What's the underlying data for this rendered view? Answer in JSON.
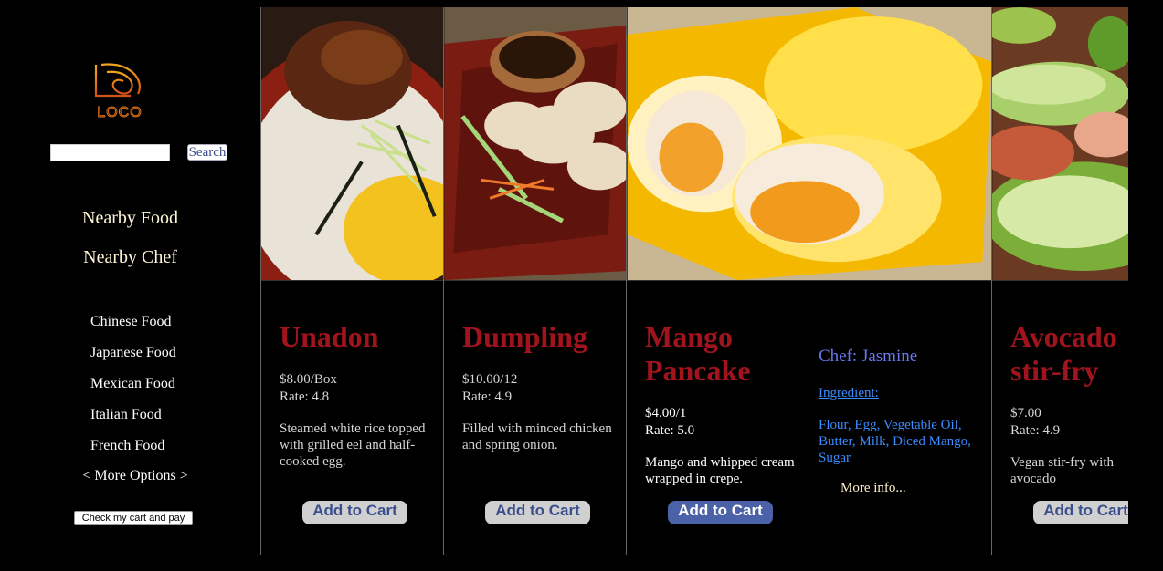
{
  "brand": {
    "logo_text": "LOCO"
  },
  "search": {
    "placeholder": "",
    "button_label": "Search"
  },
  "nav": {
    "primary": [
      "Nearby Food",
      "Nearby Chef"
    ]
  },
  "categories": [
    "Chinese Food",
    "Japanese Food",
    "Mexican Food",
    "Italian Food",
    "French Food"
  ],
  "more_options_label": "< More Options >",
  "checkout_label": "Check my cart and pay",
  "colors": {
    "title": "#a1141d",
    "link": "#3a8cff",
    "chef": "#6a78f0",
    "cart_active": "#4b62a8"
  },
  "items": [
    {
      "name": "Unadon",
      "price": "$8.00/Box",
      "rate": "Rate: 4.8",
      "desc": "Steamed white rice topped with grilled eel and half-cooked egg.",
      "cart_label": "Add to Cart"
    },
    {
      "name": "Dumpling",
      "price": "$10.00/12",
      "rate": "Rate: 4.9",
      "desc": "Filled with minced chicken and spring onion.",
      "cart_label": "Add to Cart"
    },
    {
      "name": "Mango Pancake",
      "price": "$4.00/1",
      "rate": "Rate: 5.0",
      "desc": "Mango and whipped cream wrapped in crepe.",
      "cart_label": "Add to Cart",
      "chef": "Chef: Jasmine",
      "ingredient_label": "Ingredient:",
      "ingredients": "Flour, Egg, Vegetable Oil, Butter, Milk, Diced Mango, Sugar",
      "more_info": "More info..."
    },
    {
      "name": "Avocado stir-fry",
      "price": "$7.00",
      "rate": "Rate: 4.9",
      "desc": "Vegan stir-fry with avocado",
      "cart_label": "Add to Cart"
    }
  ]
}
